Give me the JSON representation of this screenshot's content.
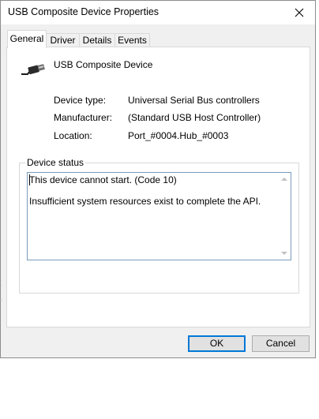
{
  "window": {
    "title": "USB Composite Device Properties"
  },
  "tabs": [
    {
      "label": "General",
      "active": true
    },
    {
      "label": "Driver",
      "active": false
    },
    {
      "label": "Details",
      "active": false
    },
    {
      "label": "Events",
      "active": false
    }
  ],
  "device": {
    "name": "USB Composite Device",
    "icon": "usb-connector-icon"
  },
  "properties": [
    {
      "label": "Device type:",
      "value": "Universal Serial Bus controllers"
    },
    {
      "label": "Manufacturer:",
      "value": "(Standard USB Host Controller)"
    },
    {
      "label": "Location:",
      "value": "Port_#0004.Hub_#0003"
    }
  ],
  "device_status": {
    "legend": "Device status",
    "line1": "This device cannot start. (Code 10)",
    "line2": "Insufficient system resources exist to complete the API."
  },
  "buttons": {
    "ok": "OK",
    "cancel": "Cancel"
  },
  "colors": {
    "accent": "#0078d7",
    "field_border": "#7a9bbd"
  }
}
